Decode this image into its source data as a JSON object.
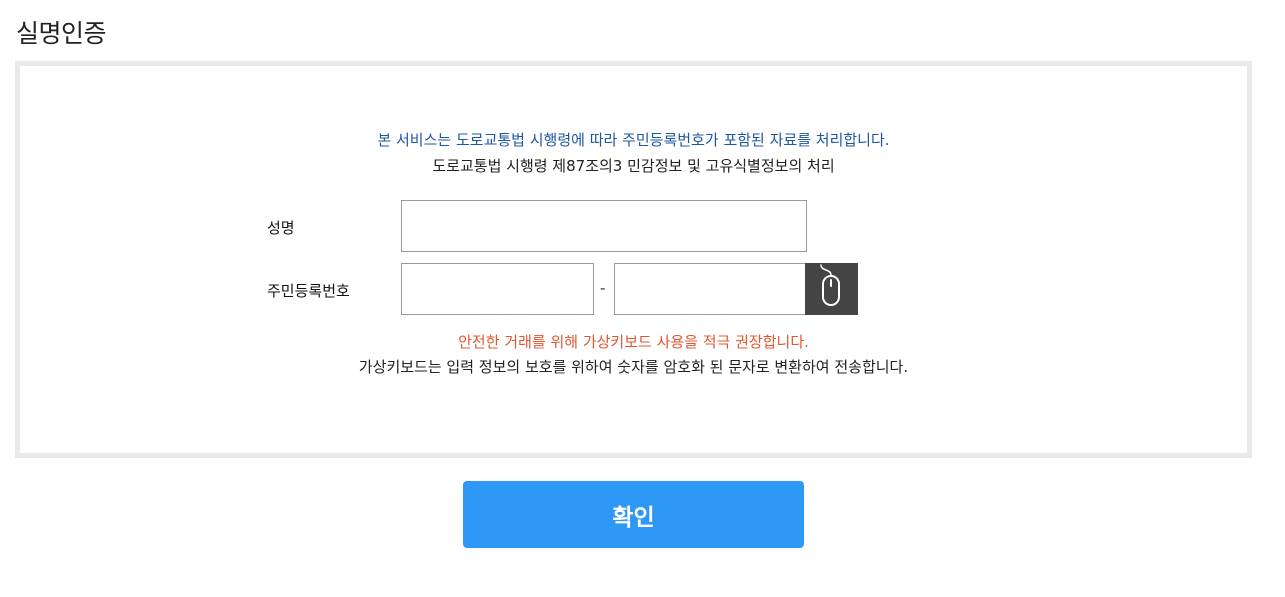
{
  "page": {
    "title": "실명인증"
  },
  "notice": {
    "service_text": "본 서비스는 도로교통법 시행령에 따라 주민등록번호가 포함된 자료를 처리합니다.",
    "law_text": "도로교통법 시행령 제87조의3 민감정보 및 고유식별정보의 처리"
  },
  "form": {
    "name_label": "성명",
    "name_value": "",
    "rrn_label": "주민등록번호",
    "rrn_front_value": "",
    "rrn_back_value": "",
    "rrn_separator": "-",
    "virtual_keyboard_icon": "mouse-icon"
  },
  "warning": {
    "recommend_text": "안전한 거래를 위해 가상키보드 사용을 적극 권장합니다.",
    "info_text": "가상키보드는 입력 정보의 보호를 위하여 숫자를 암호화 된 문자로 변환하여 전송합니다."
  },
  "actions": {
    "confirm_label": "확인"
  },
  "colors": {
    "notice_blue": "#1e57a3",
    "warning_red": "#e4572e",
    "confirm_button": "#2d98f5",
    "keyboard_button": "#444444",
    "panel_border": "#e9e9e9"
  }
}
